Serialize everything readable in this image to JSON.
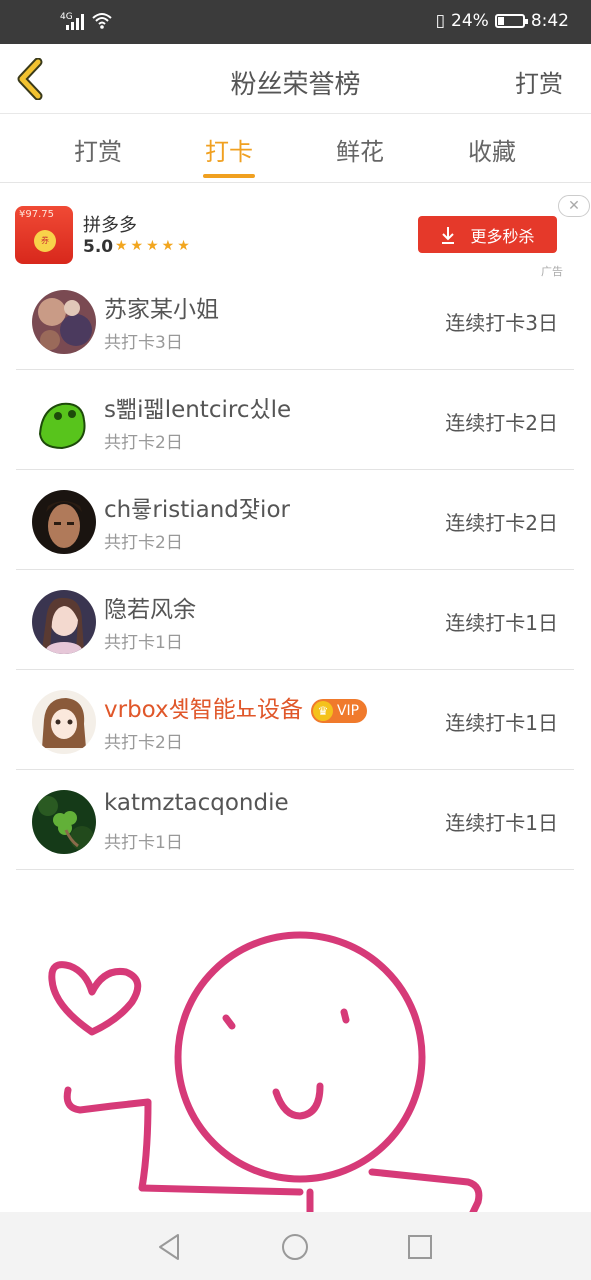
{
  "status_bar": {
    "network": "4G",
    "battery": "24%",
    "battery_level": 0.24,
    "time": "8:42"
  },
  "header": {
    "title": "粉丝荣誉榜",
    "action": "打赏"
  },
  "tabs": [
    {
      "label": "打赏",
      "active": false
    },
    {
      "label": "打卡",
      "active": true
    },
    {
      "label": "鲜花",
      "active": false
    },
    {
      "label": "收藏",
      "active": false
    }
  ],
  "ad": {
    "icon_price": "¥97.75",
    "app_name": "拼多多",
    "rating": "5.0",
    "stars": "★★★★★",
    "button_label": "更多秒杀",
    "ad_label": "广告"
  },
  "list": [
    {
      "name": "苏家某小姐",
      "total": "共打卡3日",
      "streak": "连续打卡3日",
      "vip": false,
      "avatar": "avatar-painting"
    },
    {
      "name": "s뾂i펣lentcirc싰le",
      "total": "共打卡2日",
      "streak": "连续打卡2日",
      "vip": false,
      "avatar": "avatar-green-cartoon"
    },
    {
      "name": "ch륳ristiand쟟ior",
      "total": "共打卡2日",
      "streak": "连续打卡2日",
      "vip": false,
      "avatar": "avatar-man"
    },
    {
      "name": "隐若风余",
      "total": "共打卡1日",
      "streak": "连续打卡1日",
      "vip": false,
      "avatar": "avatar-anime-girl"
    },
    {
      "name": "vrbox솆智能뇨设备",
      "total": "共打卡2日",
      "streak": "连续打卡1日",
      "vip": true,
      "vip_label": "VIP",
      "avatar": "avatar-manga"
    },
    {
      "name": "katmztacqondie",
      "total": "共打卡1日",
      "streak": "连续打卡1日",
      "vip": false,
      "avatar": "avatar-clover"
    }
  ],
  "colors": {
    "accent": "#f0a020",
    "ad_button": "#e5392a",
    "vip_name": "#e0572a",
    "doodle": "#d63a78"
  }
}
